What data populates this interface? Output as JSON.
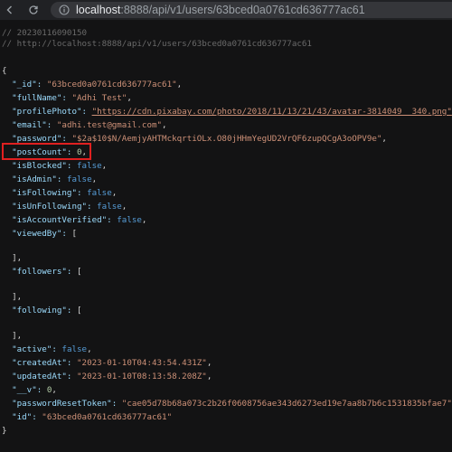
{
  "browser": {
    "url_host": "localhost",
    "url_path": ":8888/api/v1/users/63bced0a0761cd636777ac61"
  },
  "comments": {
    "timestamp": "// 20230116090150",
    "request_url": "// http://localhost:8888/api/v1/users/63bced0a0761cd636777ac61"
  },
  "json": {
    "open_brace": "{",
    "close_brace": "}",
    "id_key": "\"_id\": ",
    "id_val": "\"63bced0a0761cd636777ac61\"",
    "fullName_key": "\"fullName\": ",
    "fullName_val": "\"Adhi Test\"",
    "profilePhoto_key": "\"profilePhoto\": ",
    "profilePhoto_val": "\"https://cdn.pixabay.com/photo/2018/11/13/21/43/avatar-3814049__340.png\"",
    "email_key": "\"email\": ",
    "email_val": "\"adhi.test@gmail.com\"",
    "password_key": "\"password\": ",
    "password_val": "\"$2a$10$N/AemjyAHTMckqrtiOLx.O80jHHmYegUD2VrQF6zupQCgA3oOPV9e\"",
    "postCount_key": "\"postCount\": ",
    "postCount_val": "0",
    "isBlocked_key": "\"isBlocked\": ",
    "isBlocked_val": "false",
    "isAdmin_key": "\"isAdmin\": ",
    "isAdmin_val": "false",
    "isFollowing_key": "\"isFollowing\": ",
    "isFollowing_val": "false",
    "isUnFollowing_key": "\"isUnFollowing\": ",
    "isUnFollowing_val": "false",
    "isAccountVerified_key": "\"isAccountVerified\": ",
    "isAccountVerified_val": "false",
    "viewedBy_key": "\"viewedBy\": ",
    "open_bracket": "[",
    "close_bracket_comma": "],",
    "followers_key": "\"followers\": ",
    "following_key": "\"following\": ",
    "active_key": "\"active\": ",
    "active_val": "false",
    "createdAt_key": "\"createdAt\": ",
    "createdAt_val": "\"2023-01-10T04:43:54.431Z\"",
    "updatedAt_key": "\"updatedAt\": ",
    "updatedAt_val": "\"2023-01-10T08:13:58.208Z\"",
    "v_key": "\"__v\": ",
    "v_val": "0",
    "passwordResetToken_key": "\"passwordResetToken\": ",
    "passwordResetToken_val": "\"cae05d78b68a073c2b26f0608756ae343d6273ed19e7aa8b7b6c1531835bfae7\"",
    "id2_key": "\"id\": ",
    "id2_val": "\"63bced0a0761cd636777ac61\""
  },
  "punct": {
    "comma": ","
  },
  "icons": {
    "back": "back-icon",
    "reload": "reload-icon",
    "info": "info-icon"
  },
  "colors": {
    "background": "#131314",
    "key": "#9cdcfe",
    "string": "#ce9178",
    "boolean": "#569cd6",
    "number": "#b5cea8",
    "highlight": "#e02020"
  }
}
